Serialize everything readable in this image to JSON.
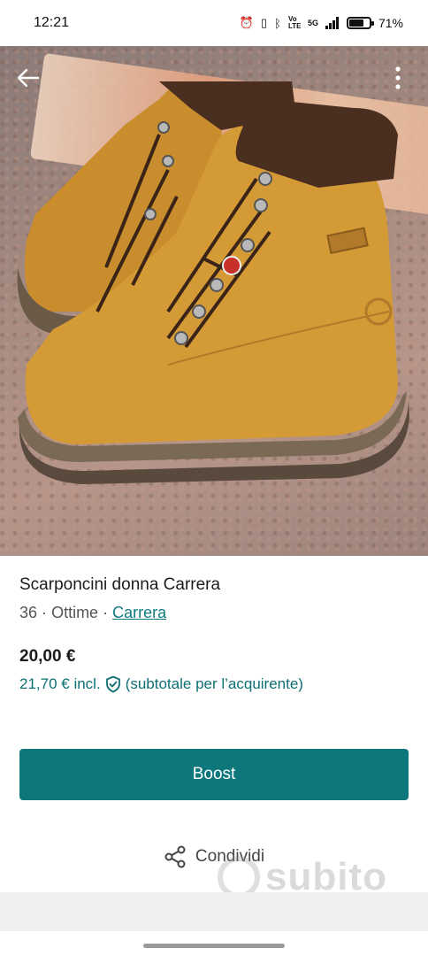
{
  "status_bar": {
    "time": "12:21",
    "battery_percent": "71%",
    "battery_level": 0.71,
    "network": "5G",
    "volte": "Vo LTE"
  },
  "listing": {
    "title": "Scarponcini donna Carrera",
    "size": "36",
    "condition": "Ottime",
    "separator": "·",
    "brand": "Carrera",
    "price": "20,00 €",
    "buyer_price": "21,70 € incl.",
    "buyer_note": "(subtotale per l’acquirente)"
  },
  "actions": {
    "boost_label": "Boost",
    "share_label": "Condividi"
  },
  "watermark": {
    "text": "subito"
  },
  "colors": {
    "accent": "#0e777c",
    "link": "#0e7c82",
    "buyer_text": "#0e6f75"
  },
  "icons": {
    "back": "arrow-left-icon",
    "more": "more-vertical-icon",
    "shield": "shield-check-icon",
    "share": "share-icon",
    "alarm": "alarm-icon",
    "vibrate": "vibrate-icon",
    "bluetooth": "bluetooth-icon",
    "signal": "signal-icon",
    "battery": "battery-icon"
  }
}
